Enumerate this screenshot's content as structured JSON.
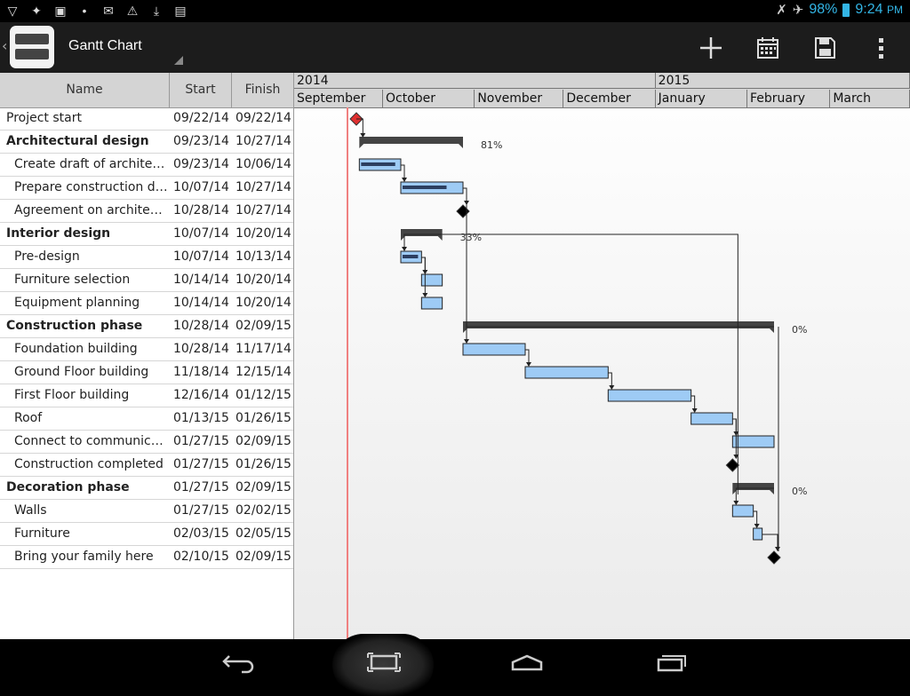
{
  "status_bar": {
    "left_icons": [
      "wifi-signal-icon",
      "usb-icon",
      "image-icon",
      "voicemail-icon",
      "email-icon",
      "warning-icon",
      "download-icon",
      "briefcase-icon"
    ],
    "battery_percent": "98%",
    "time": "9:24",
    "time_suffix": "PM"
  },
  "action_bar": {
    "title": "Gantt Chart",
    "buttons": [
      "add-icon",
      "calendar-icon",
      "save-icon",
      "overflow-menu-icon"
    ]
  },
  "table": {
    "headers": {
      "name": "Name",
      "start": "Start",
      "finish": "Finish"
    },
    "rows": [
      {
        "name": "Project start",
        "start": "09/22/14",
        "finish": "09/22/14",
        "bold": false,
        "indent": 0
      },
      {
        "name": "Architectural design",
        "start": "09/23/14",
        "finish": "10/27/14",
        "bold": true,
        "indent": 0
      },
      {
        "name": "Create draft of architecture",
        "start": "09/23/14",
        "finish": "10/06/14",
        "bold": false,
        "indent": 1
      },
      {
        "name": "Prepare construction documents",
        "start": "10/07/14",
        "finish": "10/27/14",
        "bold": false,
        "indent": 1
      },
      {
        "name": "Agreement on architectural plan",
        "start": "10/28/14",
        "finish": "10/27/14",
        "bold": false,
        "indent": 1
      },
      {
        "name": "Interior design",
        "start": "10/07/14",
        "finish": "10/20/14",
        "bold": true,
        "indent": 0
      },
      {
        "name": "Pre-design",
        "start": "10/07/14",
        "finish": "10/13/14",
        "bold": false,
        "indent": 1
      },
      {
        "name": "Furniture selection",
        "start": "10/14/14",
        "finish": "10/20/14",
        "bold": false,
        "indent": 1
      },
      {
        "name": "Equipment planning",
        "start": "10/14/14",
        "finish": "10/20/14",
        "bold": false,
        "indent": 1
      },
      {
        "name": "Construction phase",
        "start": "10/28/14",
        "finish": "02/09/15",
        "bold": true,
        "indent": 0
      },
      {
        "name": "Foundation building",
        "start": "10/28/14",
        "finish": "11/17/14",
        "bold": false,
        "indent": 1
      },
      {
        "name": "Ground Floor building",
        "start": "11/18/14",
        "finish": "12/15/14",
        "bold": false,
        "indent": 1
      },
      {
        "name": "First Floor building",
        "start": "12/16/14",
        "finish": "01/12/15",
        "bold": false,
        "indent": 1
      },
      {
        "name": "Roof",
        "start": "01/13/15",
        "finish": "01/26/15",
        "bold": false,
        "indent": 1
      },
      {
        "name": "Connect to communications",
        "start": "01/27/15",
        "finish": "02/09/15",
        "bold": false,
        "indent": 1
      },
      {
        "name": "Construction completed",
        "start": "01/27/15",
        "finish": "01/26/15",
        "bold": false,
        "indent": 1
      },
      {
        "name": "Decoration phase",
        "start": "01/27/15",
        "finish": "02/09/15",
        "bold": true,
        "indent": 0
      },
      {
        "name": "Walls",
        "start": "01/27/15",
        "finish": "02/02/15",
        "bold": false,
        "indent": 1
      },
      {
        "name": "Furniture",
        "start": "02/03/15",
        "finish": "02/05/15",
        "bold": false,
        "indent": 1
      },
      {
        "name": "Bring your family here",
        "start": "02/10/15",
        "finish": "02/09/15",
        "bold": false,
        "indent": 1
      }
    ]
  },
  "timeline": {
    "years": [
      {
        "label": "2014",
        "months": 4
      },
      {
        "label": "2015",
        "months": 3
      }
    ],
    "months": [
      "September",
      "October",
      "November",
      "December",
      "January",
      "February",
      "March"
    ]
  },
  "gantt": {
    "today": "09/22/14",
    "progress_labels": {
      "architectural_design": "81%",
      "interior_design": "33%",
      "construction_phase": "0%",
      "decoration_phase": "0%"
    },
    "colors": {
      "task_fill": "#9ecbf5",
      "summary": "#444444",
      "milestone": "#000000",
      "start_milestone": "#e03030",
      "today_line": "#f08080"
    }
  },
  "nav_bar": {
    "buttons": [
      "back-icon",
      "recent-screenshot-icon",
      "home-icon",
      "recent-apps-icon"
    ]
  }
}
